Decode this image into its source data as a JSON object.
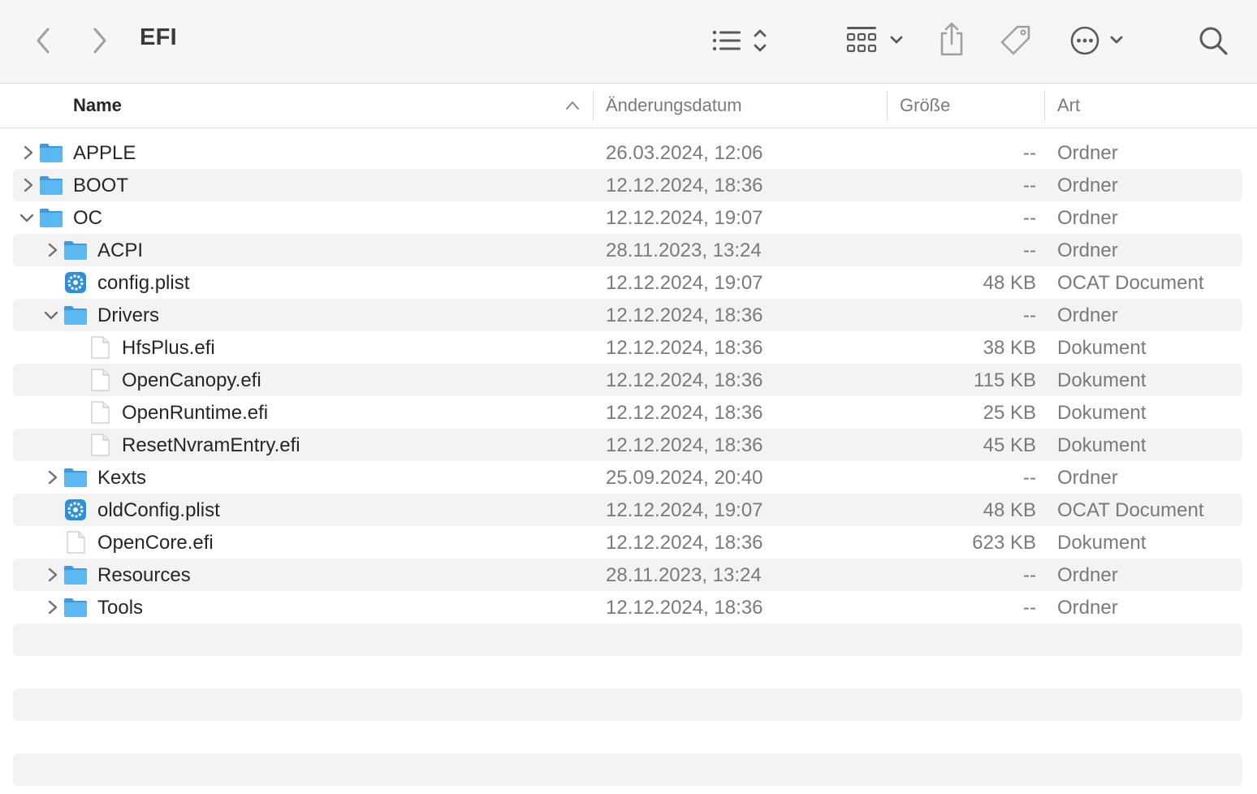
{
  "window": {
    "title": "EFI"
  },
  "toolbar": {
    "back_icon": "chevron-left-icon",
    "forward_icon": "chevron-right-icon",
    "view_options_icon": "list-view-icon",
    "group_icon": "grid-group-icon",
    "share_icon": "share-icon",
    "tag_icon": "tag-icon",
    "more_icon": "ellipsis-circle-icon",
    "search_icon": "search-icon"
  },
  "columns": {
    "name": "Name",
    "date": "Änderungsdatum",
    "size": "Größe",
    "kind": "Art",
    "sort_indicator": "ascending"
  },
  "rows": [
    {
      "name": "APPLE",
      "date": "26.03.2024, 12:06",
      "size": "--",
      "kind": "Ordner"
    },
    {
      "name": "BOOT",
      "date": "12.12.2024, 18:36",
      "size": "--",
      "kind": "Ordner"
    },
    {
      "name": "OC",
      "date": "12.12.2024, 19:07",
      "size": "--",
      "kind": "Ordner"
    },
    {
      "name": "ACPI",
      "date": "28.11.2023, 13:24",
      "size": "--",
      "kind": "Ordner"
    },
    {
      "name": "config.plist",
      "date": "12.12.2024, 19:07",
      "size": "48 KB",
      "kind": "OCAT Document"
    },
    {
      "name": "Drivers",
      "date": "12.12.2024, 18:36",
      "size": "--",
      "kind": "Ordner"
    },
    {
      "name": "HfsPlus.efi",
      "date": "12.12.2024, 18:36",
      "size": "38 KB",
      "kind": "Dokument"
    },
    {
      "name": "OpenCanopy.efi",
      "date": "12.12.2024, 18:36",
      "size": "115 KB",
      "kind": "Dokument"
    },
    {
      "name": "OpenRuntime.efi",
      "date": "12.12.2024, 18:36",
      "size": "25 KB",
      "kind": "Dokument"
    },
    {
      "name": "ResetNvramEntry.efi",
      "date": "12.12.2024, 18:36",
      "size": "45 KB",
      "kind": "Dokument"
    },
    {
      "name": "Kexts",
      "date": "25.09.2024, 20:40",
      "size": "--",
      "kind": "Ordner"
    },
    {
      "name": "oldConfig.plist",
      "date": "12.12.2024, 19:07",
      "size": "48 KB",
      "kind": "OCAT Document"
    },
    {
      "name": "OpenCore.efi",
      "date": "12.12.2024, 18:36",
      "size": "623 KB",
      "kind": "Dokument"
    },
    {
      "name": "Resources",
      "date": "28.11.2023, 13:24",
      "size": "--",
      "kind": "Ordner"
    },
    {
      "name": "Tools",
      "date": "12.12.2024, 18:36",
      "size": "--",
      "kind": "Ordner"
    }
  ],
  "colors": {
    "folder": "#5cb8f0",
    "folder_dark": "#3d9ae0",
    "stripe": "#f3f3f4",
    "toolbar_bg": "#f6f6f8"
  }
}
